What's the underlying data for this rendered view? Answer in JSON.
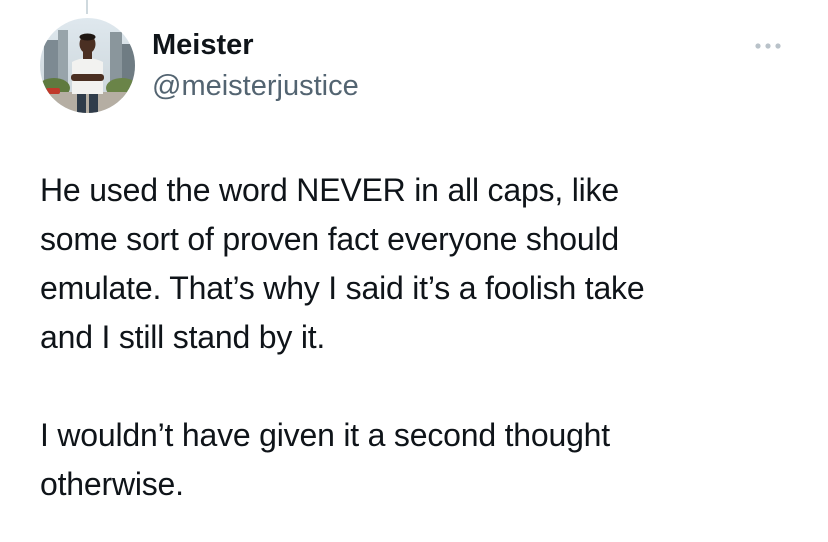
{
  "tweet": {
    "author": {
      "display_name": "Meister",
      "handle": "@meisterjustice",
      "avatar_icon": "profile-photo"
    },
    "more_icon": "more-horizontal-icon",
    "text_paragraphs": [
      [
        "He used the word NEVER in all caps, like",
        "some sort of proven fact everyone should",
        "emulate. That’s why I said it’s a foolish take",
        "and I still stand by it."
      ],
      [
        "I wouldn’t have given it a second thought",
        "otherwise."
      ]
    ]
  },
  "colors": {
    "text_primary": "#0f1419",
    "text_secondary": "#536471",
    "more_dots": "#b9c2c9",
    "thread_line": "#cfd9de"
  }
}
